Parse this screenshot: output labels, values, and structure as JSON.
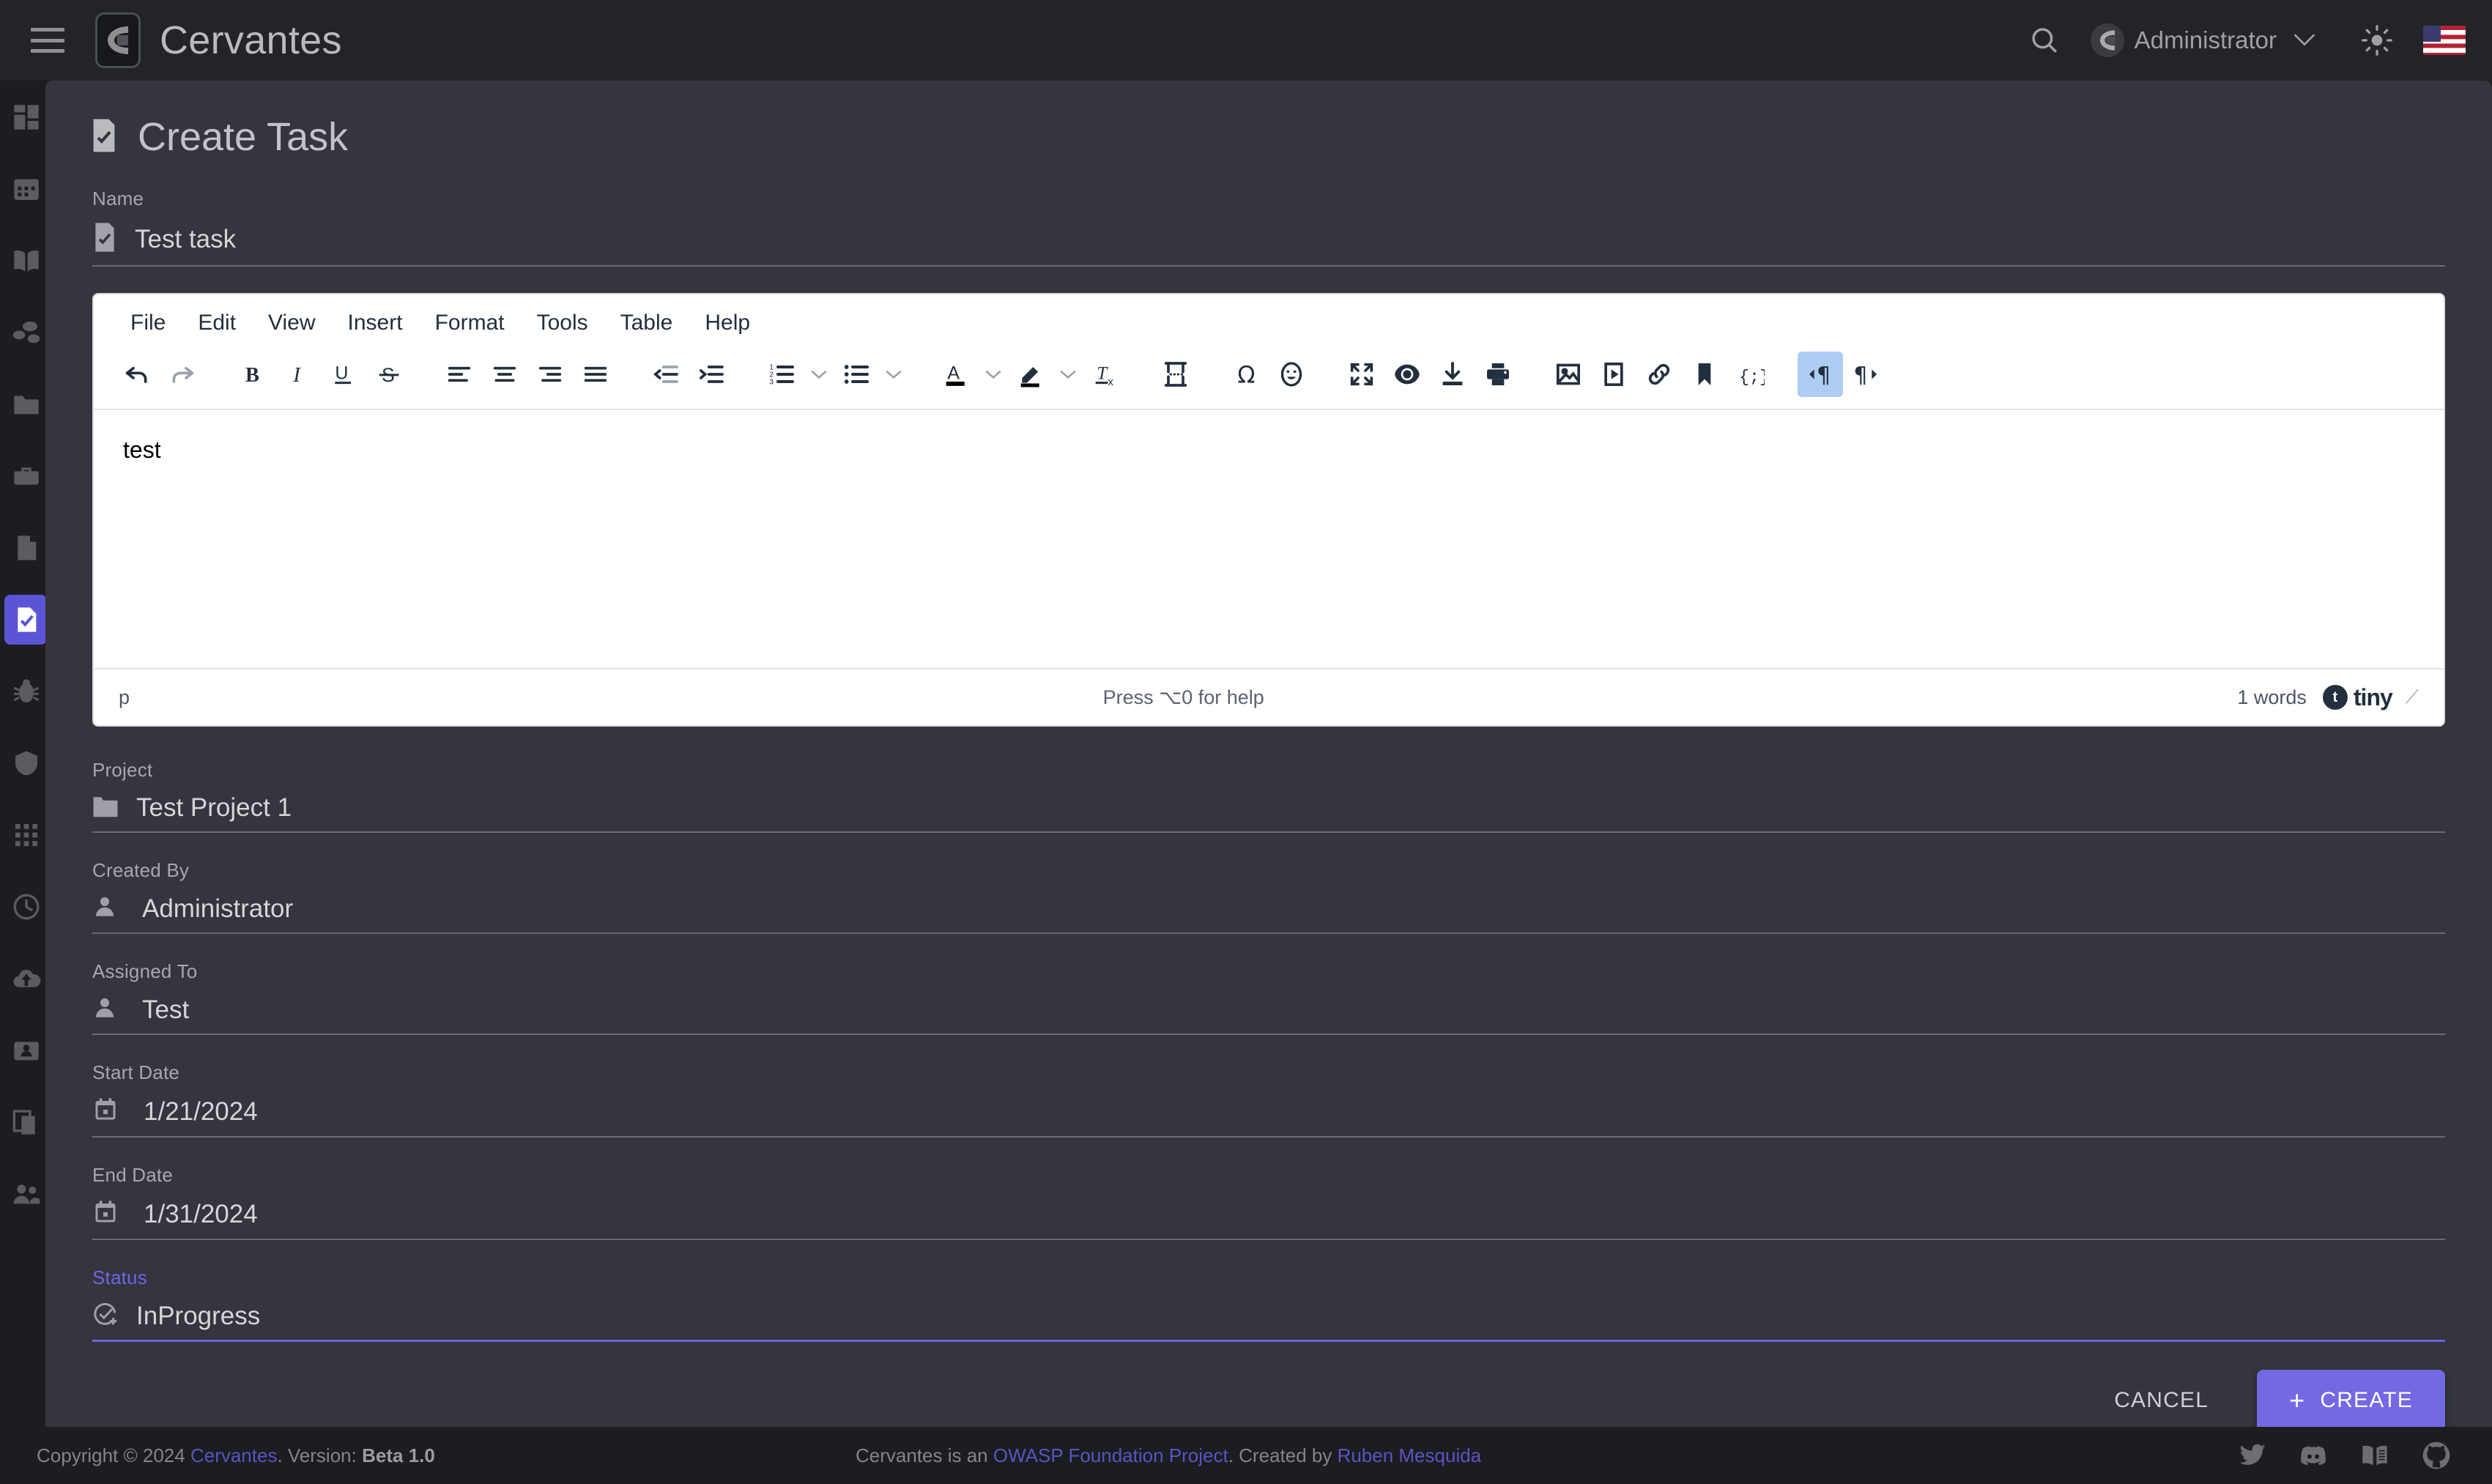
{
  "app": {
    "brand": "Cervantes",
    "user": "Administrator",
    "icons": {
      "menu": "hamburger-icon",
      "search": "search-icon",
      "theme": "sun-icon",
      "language": "us-flag-icon",
      "chevron": "chevron-down-icon"
    }
  },
  "sidebar": {
    "items": [
      {
        "name": "dashboard",
        "icon": "dashboard-icon",
        "active": false
      },
      {
        "name": "calendar",
        "icon": "calendar-icon",
        "active": false
      },
      {
        "name": "knowledge-base",
        "icon": "book-icon",
        "active": false
      },
      {
        "name": "organizations",
        "icon": "network-icon",
        "active": false
      },
      {
        "name": "projects",
        "icon": "folder-icon",
        "active": false
      },
      {
        "name": "clients",
        "icon": "briefcase-icon",
        "active": false
      },
      {
        "name": "reports",
        "icon": "document-icon",
        "active": false
      },
      {
        "name": "tasks",
        "icon": "task-check-icon",
        "active": true
      },
      {
        "name": "vulnerabilities",
        "icon": "bug-icon",
        "active": false
      },
      {
        "name": "templates",
        "icon": "shield-icon",
        "active": false
      },
      {
        "name": "apps",
        "icon": "grid-icon",
        "active": false
      },
      {
        "name": "time-tracking",
        "icon": "clock-icon",
        "active": false
      },
      {
        "name": "uploads",
        "icon": "cloud-upload-icon",
        "active": false
      },
      {
        "name": "profile",
        "icon": "id-card-icon",
        "active": false
      },
      {
        "name": "notes",
        "icon": "notes-icon",
        "active": false
      },
      {
        "name": "users",
        "icon": "users-icon",
        "active": false
      }
    ]
  },
  "page": {
    "title": "Create Task",
    "title_icon": "task-document-icon"
  },
  "form": {
    "name": {
      "label": "Name",
      "value": "Test task",
      "icon": "task-document-icon"
    },
    "project": {
      "label": "Project",
      "value": "Test Project 1",
      "icon": "folder-icon"
    },
    "created_by": {
      "label": "Created By",
      "value": "Administrator",
      "icon": "person-icon"
    },
    "assigned_to": {
      "label": "Assigned To",
      "value": "Test",
      "icon": "person-icon"
    },
    "start_date": {
      "label": "Start Date",
      "value": "1/21/2024",
      "icon": "calendar-icon"
    },
    "end_date": {
      "label": "End Date",
      "value": "1/31/2024",
      "icon": "calendar-icon"
    },
    "status": {
      "label": "Status",
      "value": "InProgress",
      "icon": "check-circle-plus-icon",
      "accent_color": "#6f63e8"
    }
  },
  "editor": {
    "menubar": [
      "File",
      "Edit",
      "View",
      "Insert",
      "Format",
      "Tools",
      "Table",
      "Help"
    ],
    "toolbar": [
      {
        "name": "undo-icon",
        "active": false
      },
      {
        "name": "redo-icon",
        "active": false
      },
      {
        "sep": true
      },
      {
        "name": "bold-icon",
        "active": false
      },
      {
        "name": "italic-icon",
        "active": false
      },
      {
        "name": "underline-icon",
        "active": false
      },
      {
        "name": "strikethrough-icon",
        "active": false
      },
      {
        "sep": true
      },
      {
        "name": "align-left-icon",
        "active": false
      },
      {
        "name": "align-center-icon",
        "active": false
      },
      {
        "name": "align-right-icon",
        "active": false
      },
      {
        "name": "align-justify-icon",
        "active": false
      },
      {
        "sep": true
      },
      {
        "name": "outdent-icon",
        "active": false
      },
      {
        "name": "indent-icon",
        "active": false
      },
      {
        "sep": true
      },
      {
        "name": "numbered-list-icon",
        "active": false,
        "caret": true
      },
      {
        "name": "bullet-list-icon",
        "active": false,
        "caret": true
      },
      {
        "sep": true
      },
      {
        "name": "text-color-icon",
        "active": false,
        "caret": true
      },
      {
        "name": "highlight-color-icon",
        "active": false,
        "caret": true
      },
      {
        "name": "clear-formatting-icon",
        "active": false
      },
      {
        "sep": true
      },
      {
        "name": "page-break-icon",
        "active": false
      },
      {
        "sep": true
      },
      {
        "name": "special-character-icon",
        "active": false
      },
      {
        "name": "emoticon-icon",
        "active": false
      },
      {
        "sep": true
      },
      {
        "name": "fullscreen-icon",
        "active": false
      },
      {
        "name": "preview-icon",
        "active": false
      },
      {
        "name": "export-icon",
        "active": false
      },
      {
        "name": "print-icon",
        "active": false
      },
      {
        "sep": true
      },
      {
        "name": "insert-image-icon",
        "active": false
      },
      {
        "name": "insert-media-icon",
        "active": false
      },
      {
        "name": "insert-link-icon",
        "active": false
      },
      {
        "name": "anchor-icon",
        "active": false
      },
      {
        "name": "source-code-icon",
        "active": false
      },
      {
        "sep": true
      },
      {
        "name": "ltr-direction-icon",
        "active": true
      },
      {
        "name": "rtl-direction-icon",
        "active": false
      }
    ],
    "content": "test",
    "status": {
      "path": "p",
      "help": "Press ⌥0 for help",
      "words": "1 words",
      "branding": "tiny"
    }
  },
  "actions": {
    "cancel": "CANCEL",
    "create": "CREATE",
    "create_icon": "plus-icon"
  },
  "footer": {
    "copyright_prefix": "Copyright © 2024 ",
    "brand_link": "Cervantes",
    "version_label": ". Version: ",
    "version": "Beta 1.0",
    "center_prefix": "Cervantes is an ",
    "center_link1": "OWASP Foundation Project",
    "center_mid": ". Created by ",
    "center_link2": "Ruben Mesquida",
    "social": [
      "twitter-icon",
      "discord-icon",
      "docs-icon",
      "github-icon"
    ]
  }
}
